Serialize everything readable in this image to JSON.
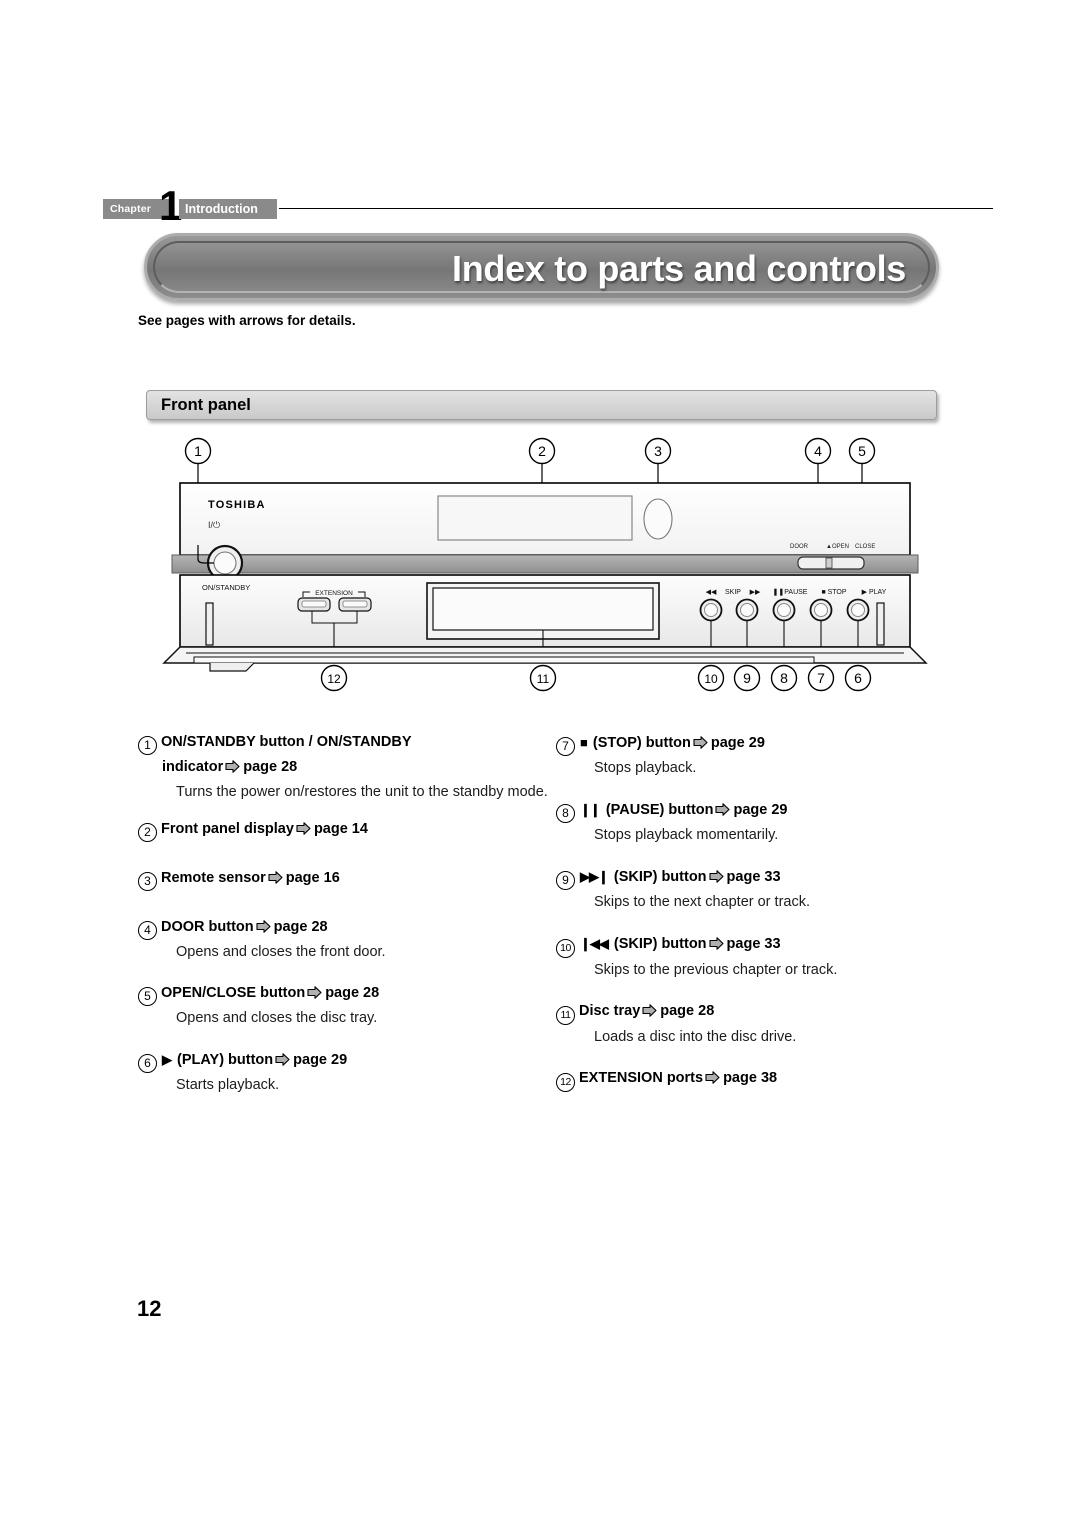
{
  "chapter": {
    "label": "Chapter",
    "number": "1",
    "title": "Introduction"
  },
  "page_title": "Index to parts and controls",
  "intro_note": "See pages with arrows for details.",
  "section": {
    "title": "Front panel"
  },
  "diagram": {
    "brand": "TOSHIBA",
    "power_symbol": "I/⏼",
    "power_label": "ON/STANDBY",
    "extension_label": "EXTENSION",
    "door_label": "DOOR",
    "open_label": "OPEN",
    "close_label": "CLOSE",
    "transport_labels": {
      "skip_prev": "◀◀",
      "skip": "SKIP",
      "skip_next": "▶▶",
      "pause": "PAUSE",
      "stop": "STOP",
      "play": "PLAY"
    },
    "callouts_top": [
      "1",
      "2",
      "3",
      "4",
      "5"
    ],
    "callouts_bottom": [
      "12",
      "11",
      "10",
      "9",
      "8",
      "7",
      "6"
    ]
  },
  "entries_left": [
    {
      "num": "1",
      "glyph": "",
      "title_line1": "ON/STANDBY button / ON/STANDBY",
      "title_line2": "indicator",
      "page": "page 28",
      "body": "Turns the power on/restores the unit to the standby mode."
    },
    {
      "num": "2",
      "glyph": "",
      "title_line1": "Front panel display",
      "title_line2": "",
      "page": "page 14",
      "body": ""
    },
    {
      "num": "3",
      "glyph": "",
      "title_line1": "Remote sensor",
      "title_line2": "",
      "page": "page 16",
      "body": ""
    },
    {
      "num": "4",
      "glyph": "",
      "title_line1": "DOOR button",
      "title_line2": "",
      "page": "page 28",
      "body": "Opens and closes the front door."
    },
    {
      "num": "5",
      "glyph": "",
      "title_line1": "OPEN/CLOSE button",
      "title_line2": "",
      "page": "page 28",
      "body": "Opens and closes the disc tray."
    },
    {
      "num": "6",
      "glyph": "▶",
      "title_line1": "(PLAY) button",
      "title_line2": "",
      "page": "page 29",
      "body": "Starts playback."
    }
  ],
  "entries_right": [
    {
      "num": "7",
      "glyph": "■",
      "title_line1": "(STOP) button",
      "title_line2": "",
      "page": "page 29",
      "body": "Stops playback."
    },
    {
      "num": "8",
      "glyph": "❙❙",
      "title_line1": "(PAUSE) button",
      "title_line2": "",
      "page": "page 29",
      "body": "Stops playback momentarily."
    },
    {
      "num": "9",
      "glyph": "▶▶❙",
      "title_line1": "(SKIP) button",
      "title_line2": "",
      "page": "page 33",
      "body": "Skips to the next chapter or track."
    },
    {
      "num": "10",
      "glyph": "❙◀◀",
      "title_line1": "(SKIP) button",
      "title_line2": "",
      "page": "page 33",
      "body": "Skips to the previous chapter or track."
    },
    {
      "num": "11",
      "glyph": "",
      "title_line1": "Disc tray",
      "title_line2": "",
      "page": "page 28",
      "body": "Loads a disc into the disc drive."
    },
    {
      "num": "12",
      "glyph": "",
      "title_line1": "EXTENSION ports",
      "title_line2": "",
      "page": "page 38",
      "body": ""
    }
  ],
  "footer": {
    "page_number": "12"
  },
  "colors": {
    "header_gray": "#8a8a8a",
    "title_pill": "#7c7c7c",
    "section_bar": "#d6d6d6",
    "arrow_fill": "#b0b0b0"
  }
}
